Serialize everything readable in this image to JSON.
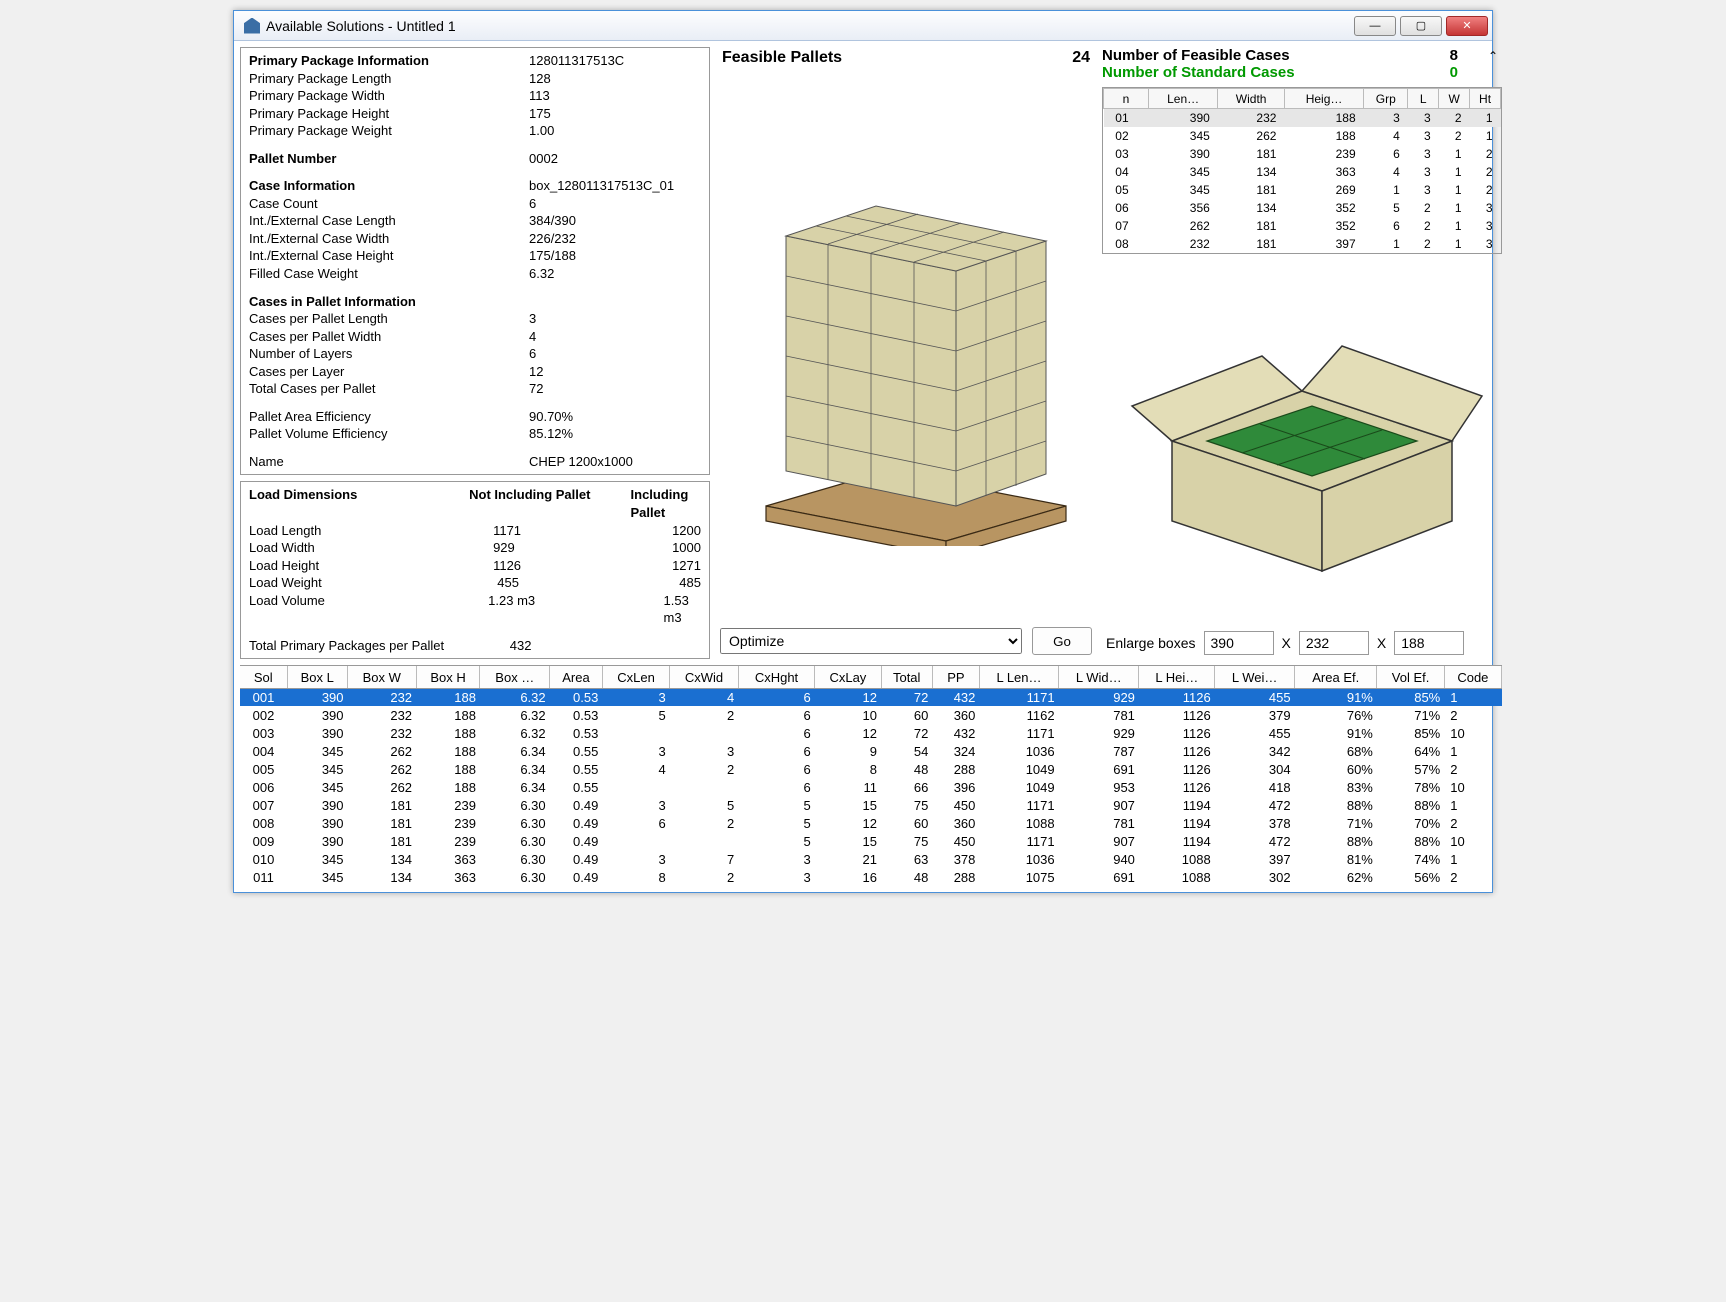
{
  "window": {
    "title": "Available Solutions - Untitled 1"
  },
  "primary": {
    "header": "Primary Package Information",
    "header_val": "128011317513C",
    "length_lbl": "Primary Package Length",
    "length": "128",
    "width_lbl": "Primary Package Width",
    "width": "113",
    "height_lbl": "Primary Package Height",
    "height": "175",
    "weight_lbl": "Primary Package Weight",
    "weight": "1.00"
  },
  "pallet_number": {
    "lbl": "Pallet Number",
    "val": "0002"
  },
  "case_info": {
    "header": "Case Information",
    "header_val": "box_128011317513C_01",
    "count_lbl": "Case Count",
    "count": "6",
    "len_lbl": "Int./External Case Length",
    "len": "384/390",
    "wid_lbl": "Int./External Case Width",
    "wid": "226/232",
    "hgt_lbl": "Int./External Case Height",
    "hgt": "175/188",
    "fill_lbl": "Filled Case Weight",
    "fill": "6.32"
  },
  "cpi": {
    "header": "Cases in Pallet Information",
    "cpl_lbl": "Cases per Pallet Length",
    "cpl": "3",
    "cpw_lbl": "Cases per Pallet Width",
    "cpw": "4",
    "nl_lbl": "Number of Layers",
    "nl": "6",
    "cply_lbl": "Cases per Layer",
    "cply": "12",
    "tcp_lbl": "Total Cases per Pallet",
    "tcp": "72"
  },
  "eff": {
    "area_lbl": "Pallet Area Efficiency",
    "area": "90.70%",
    "vol_lbl": "Pallet Volume Efficiency",
    "vol": "85.12%"
  },
  "name_row": {
    "lbl": "Name",
    "val": "CHEP 1200x1000"
  },
  "dims": {
    "header": "Load Dimensions",
    "col2": "Not Including Pallet",
    "col3": "Including Pallet",
    "rows": [
      {
        "lbl": "Load Length",
        "a": "1171",
        "b": "1200"
      },
      {
        "lbl": "Load Width",
        "a": "929",
        "b": "1000"
      },
      {
        "lbl": "Load Height",
        "a": "1126",
        "b": "1271"
      },
      {
        "lbl": "Load Weight",
        "a": "455",
        "b": "485"
      },
      {
        "lbl": "Load Volume",
        "a": "1.23 m3",
        "b": "1.53 m3"
      }
    ],
    "total_lbl": "Total Primary Packages per Pallet",
    "total": "432"
  },
  "feasible": {
    "lbl": "Feasible Pallets",
    "val": "24"
  },
  "optimize": {
    "selected": "Optimize",
    "go": "Go"
  },
  "cases_header": {
    "feasible_lbl": "Number of Feasible Cases",
    "feasible_val": "8",
    "std_lbl": "Number of Standard Cases",
    "std_val": "0"
  },
  "cases_cols": [
    "n",
    "Len…",
    "Width",
    "Heig…",
    "Grp",
    "L",
    "W",
    "Ht"
  ],
  "cases": [
    {
      "n": "01",
      "len": "390",
      "w": "232",
      "h": "188",
      "grp": "3",
      "L": "3",
      "W": "2",
      "Ht": "1",
      "sel": true
    },
    {
      "n": "02",
      "len": "345",
      "w": "262",
      "h": "188",
      "grp": "4",
      "L": "3",
      "W": "2",
      "Ht": "1"
    },
    {
      "n": "03",
      "len": "390",
      "w": "181",
      "h": "239",
      "grp": "6",
      "L": "3",
      "W": "1",
      "Ht": "2"
    },
    {
      "n": "04",
      "len": "345",
      "w": "134",
      "h": "363",
      "grp": "4",
      "L": "3",
      "W": "1",
      "Ht": "2"
    },
    {
      "n": "05",
      "len": "345",
      "w": "181",
      "h": "269",
      "grp": "1",
      "L": "3",
      "W": "1",
      "Ht": "2"
    },
    {
      "n": "06",
      "len": "356",
      "w": "134",
      "h": "352",
      "grp": "5",
      "L": "2",
      "W": "1",
      "Ht": "3"
    },
    {
      "n": "07",
      "len": "262",
      "w": "181",
      "h": "352",
      "grp": "6",
      "L": "2",
      "W": "1",
      "Ht": "3"
    },
    {
      "n": "08",
      "len": "232",
      "w": "181",
      "h": "397",
      "grp": "1",
      "L": "2",
      "W": "1",
      "Ht": "3"
    }
  ],
  "enlarge": {
    "lbl": "Enlarge boxes",
    "l": "390",
    "w": "232",
    "h": "188",
    "x": "X"
  },
  "sol_cols": [
    "Sol",
    "Box L",
    "Box W",
    "Box H",
    "Box …",
    "Area",
    "CxLen",
    "CxWid",
    "CxHght",
    "CxLay",
    "Total",
    "PP",
    "L Len…",
    "L Wid…",
    "L Hei…",
    "L Wei…",
    "Area Ef.",
    "Vol Ef.",
    "Code"
  ],
  "solutions": [
    {
      "sol": "001",
      "bl": "390",
      "bw": "232",
      "bh": "188",
      "bwg": "6.32",
      "area": "0.53",
      "cl": "3",
      "cw": "4",
      "ch": "6",
      "clay": "12",
      "tot": "72",
      "pp": "432",
      "ll": "1171",
      "lw": "929",
      "lh": "1126",
      "lwg": "455",
      "ae": "91%",
      "ve": "85%",
      "code": "1",
      "sel": true
    },
    {
      "sol": "002",
      "bl": "390",
      "bw": "232",
      "bh": "188",
      "bwg": "6.32",
      "area": "0.53",
      "cl": "5",
      "cw": "2",
      "ch": "6",
      "clay": "10",
      "tot": "60",
      "pp": "360",
      "ll": "1162",
      "lw": "781",
      "lh": "1126",
      "lwg": "379",
      "ae": "76%",
      "ve": "71%",
      "code": "2"
    },
    {
      "sol": "003",
      "bl": "390",
      "bw": "232",
      "bh": "188",
      "bwg": "6.32",
      "area": "0.53",
      "cl": "",
      "cw": "",
      "ch": "6",
      "clay": "12",
      "tot": "72",
      "pp": "432",
      "ll": "1171",
      "lw": "929",
      "lh": "1126",
      "lwg": "455",
      "ae": "91%",
      "ve": "85%",
      "code": "10"
    },
    {
      "sol": "004",
      "bl": "345",
      "bw": "262",
      "bh": "188",
      "bwg": "6.34",
      "area": "0.55",
      "cl": "3",
      "cw": "3",
      "ch": "6",
      "clay": "9",
      "tot": "54",
      "pp": "324",
      "ll": "1036",
      "lw": "787",
      "lh": "1126",
      "lwg": "342",
      "ae": "68%",
      "ve": "64%",
      "code": "1"
    },
    {
      "sol": "005",
      "bl": "345",
      "bw": "262",
      "bh": "188",
      "bwg": "6.34",
      "area": "0.55",
      "cl": "4",
      "cw": "2",
      "ch": "6",
      "clay": "8",
      "tot": "48",
      "pp": "288",
      "ll": "1049",
      "lw": "691",
      "lh": "1126",
      "lwg": "304",
      "ae": "60%",
      "ve": "57%",
      "code": "2"
    },
    {
      "sol": "006",
      "bl": "345",
      "bw": "262",
      "bh": "188",
      "bwg": "6.34",
      "area": "0.55",
      "cl": "",
      "cw": "",
      "ch": "6",
      "clay": "11",
      "tot": "66",
      "pp": "396",
      "ll": "1049",
      "lw": "953",
      "lh": "1126",
      "lwg": "418",
      "ae": "83%",
      "ve": "78%",
      "code": "10"
    },
    {
      "sol": "007",
      "bl": "390",
      "bw": "181",
      "bh": "239",
      "bwg": "6.30",
      "area": "0.49",
      "cl": "3",
      "cw": "5",
      "ch": "5",
      "clay": "15",
      "tot": "75",
      "pp": "450",
      "ll": "1171",
      "lw": "907",
      "lh": "1194",
      "lwg": "472",
      "ae": "88%",
      "ve": "88%",
      "code": "1"
    },
    {
      "sol": "008",
      "bl": "390",
      "bw": "181",
      "bh": "239",
      "bwg": "6.30",
      "area": "0.49",
      "cl": "6",
      "cw": "2",
      "ch": "5",
      "clay": "12",
      "tot": "60",
      "pp": "360",
      "ll": "1088",
      "lw": "781",
      "lh": "1194",
      "lwg": "378",
      "ae": "71%",
      "ve": "70%",
      "code": "2"
    },
    {
      "sol": "009",
      "bl": "390",
      "bw": "181",
      "bh": "239",
      "bwg": "6.30",
      "area": "0.49",
      "cl": "",
      "cw": "",
      "ch": "5",
      "clay": "15",
      "tot": "75",
      "pp": "450",
      "ll": "1171",
      "lw": "907",
      "lh": "1194",
      "lwg": "472",
      "ae": "88%",
      "ve": "88%",
      "code": "10"
    },
    {
      "sol": "010",
      "bl": "345",
      "bw": "134",
      "bh": "363",
      "bwg": "6.30",
      "area": "0.49",
      "cl": "3",
      "cw": "7",
      "ch": "3",
      "clay": "21",
      "tot": "63",
      "pp": "378",
      "ll": "1036",
      "lw": "940",
      "lh": "1088",
      "lwg": "397",
      "ae": "81%",
      "ve": "74%",
      "code": "1"
    },
    {
      "sol": "011",
      "bl": "345",
      "bw": "134",
      "bh": "363",
      "bwg": "6.30",
      "area": "0.49",
      "cl": "8",
      "cw": "2",
      "ch": "3",
      "clay": "16",
      "tot": "48",
      "pp": "288",
      "ll": "1075",
      "lw": "691",
      "lh": "1088",
      "lwg": "302",
      "ae": "62%",
      "ve": "56%",
      "code": "2"
    }
  ]
}
